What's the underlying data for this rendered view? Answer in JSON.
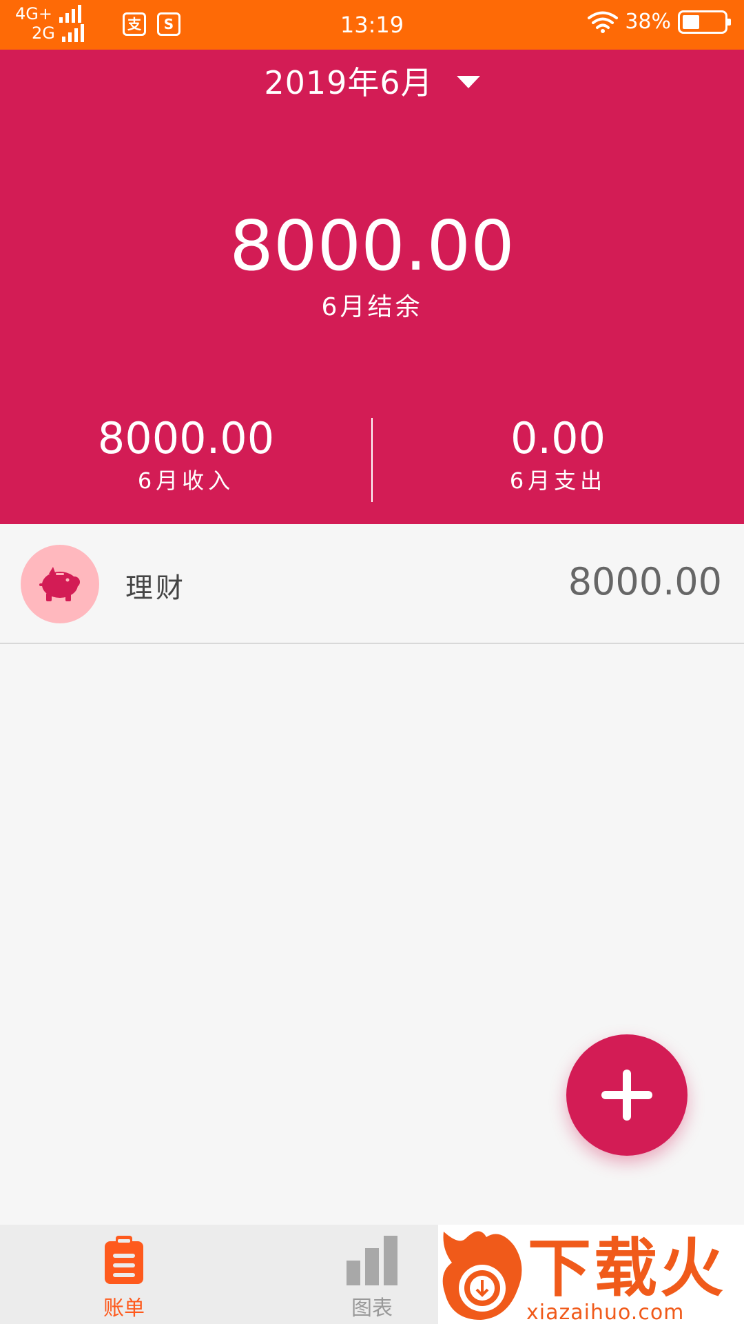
{
  "status_bar": {
    "network_top": "4G+",
    "network_bottom": "2G",
    "app_icon_1": "支",
    "app_icon_2": "S",
    "time": "13:19",
    "battery": "38%"
  },
  "header": {
    "month": "2019年6月",
    "balance_amount": "8000.00",
    "balance_label": "6月结余",
    "income_amount": "8000.00",
    "income_label": "6月收入",
    "expense_amount": "0.00",
    "expense_label": "6月支出"
  },
  "transactions": [
    {
      "category": "理财",
      "amount": "8000.00",
      "icon": "piggy-bank-icon"
    }
  ],
  "bottom_nav": {
    "items": [
      {
        "label": "账单",
        "icon": "clipboard-icon",
        "active": true
      },
      {
        "label": "图表",
        "icon": "bar-chart-icon",
        "active": false
      }
    ]
  },
  "watermark": {
    "text": "下载火",
    "url": "xiazaihuo.com"
  },
  "colors": {
    "status_bar": "#fe6a06",
    "header": "#d31c55",
    "category_circle": "#ffb8be",
    "nav_active": "#fe5a1d",
    "nav_inactive": "#999999"
  }
}
